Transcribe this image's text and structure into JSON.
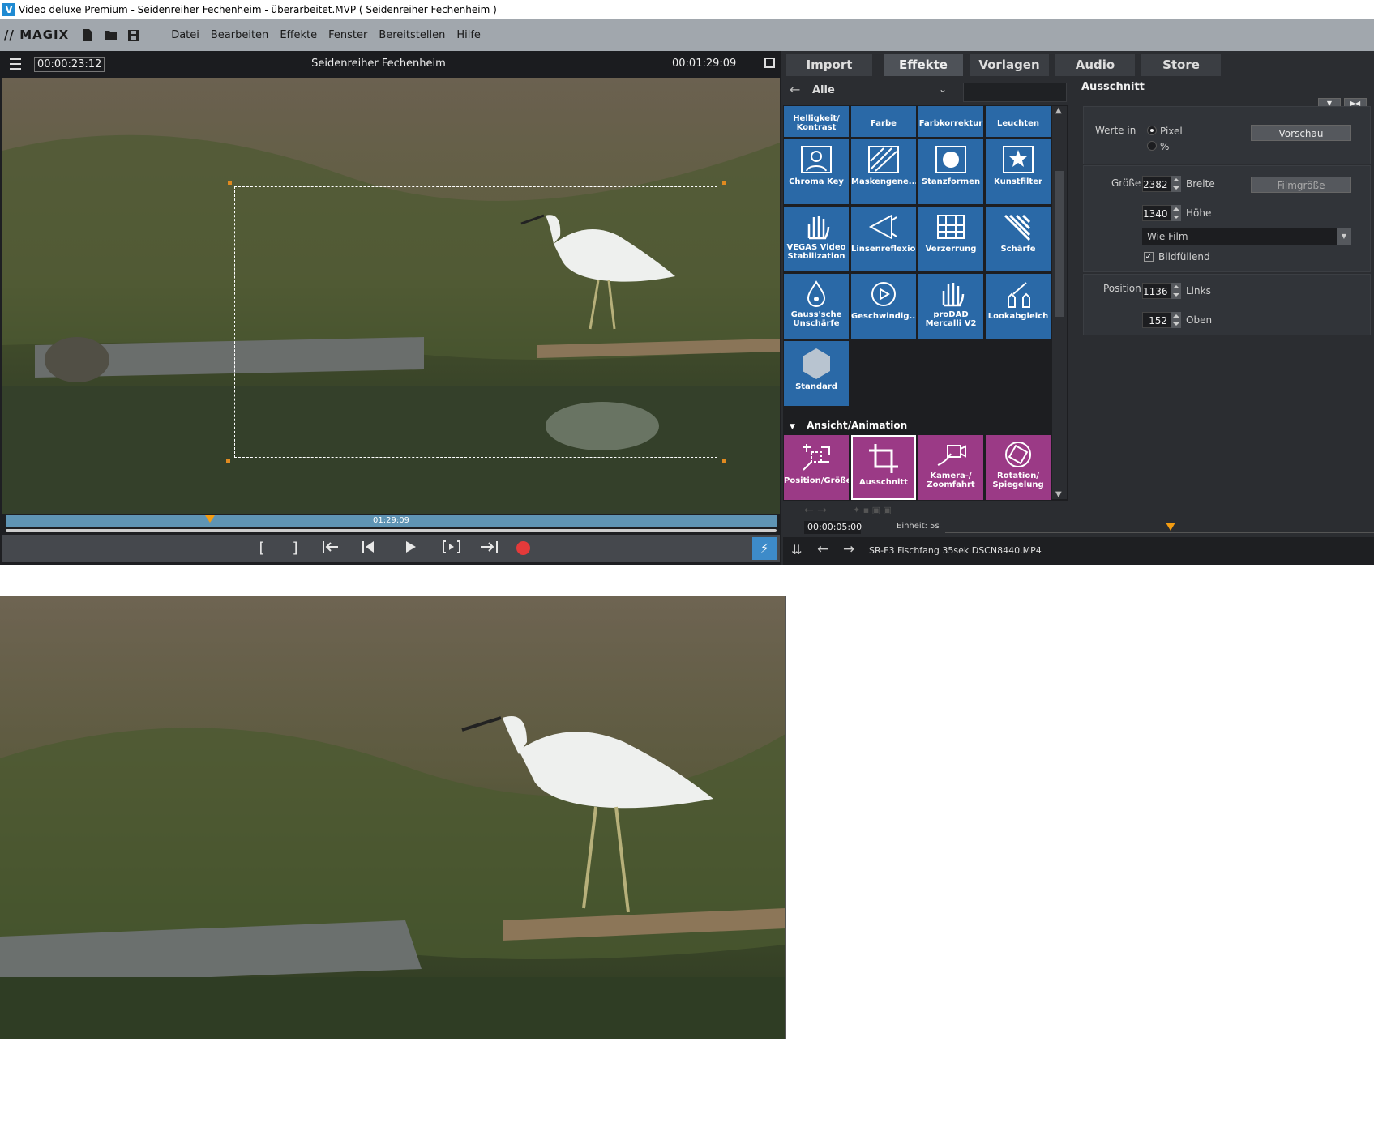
{
  "window": {
    "title": "Video deluxe Premium - Seidenreiher Fechenheim - überarbeitet.MVP ( Seidenreiher Fechenheim )",
    "logo": "V"
  },
  "brand": "MAGIX",
  "menu": [
    "Datei",
    "Bearbeiten",
    "Effekte",
    "Fenster",
    "Bereitstellen",
    "Hilfe"
  ],
  "preview": {
    "timecode_current": "00:00:23:12",
    "title": "Seidenreiher Fechenheim",
    "timecode_total": "00:01:29:09",
    "scrub_label": "01:29:09",
    "playhead_fraction": 0.265
  },
  "tabs": [
    "Import",
    "Effekte",
    "Vorlagen",
    "Audio",
    "Store"
  ],
  "browser": {
    "category": "Alle",
    "tiles": [
      {
        "label": "Helligkeit/ Kontrast",
        "icon": "brightness-icon"
      },
      {
        "label": "Farbe",
        "icon": "color-icon"
      },
      {
        "label": "Farbkorrektur",
        "icon": "color-correction-icon"
      },
      {
        "label": "Leuchten",
        "icon": "glow-icon"
      },
      {
        "label": "Chroma Key",
        "icon": "chroma-key-icon"
      },
      {
        "label": "Maskengene...",
        "icon": "mask-icon"
      },
      {
        "label": "Stanzformen",
        "icon": "shapes-icon"
      },
      {
        "label": "Kunstfilter",
        "icon": "art-filter-icon"
      },
      {
        "label": "VEGAS Video Stabilization",
        "icon": "stabilization-icon"
      },
      {
        "label": "Linsenreflexion",
        "icon": "lens-flare-icon"
      },
      {
        "label": "Verzerrung",
        "icon": "distortion-icon"
      },
      {
        "label": "Schärfe",
        "icon": "sharpness-icon"
      },
      {
        "label": "Gauss'sche Unschärfe",
        "icon": "blur-icon"
      },
      {
        "label": "Geschwindig...",
        "icon": "speed-icon"
      },
      {
        "label": "proDAD Mercalli V2",
        "icon": "mercalli-icon"
      },
      {
        "label": "Lookabgleich",
        "icon": "look-match-icon"
      },
      {
        "label": "Standard",
        "icon": "hexagon-icon"
      }
    ],
    "section": "Ansicht/Animation",
    "anim_tiles": [
      {
        "label": "Position/Größe",
        "icon": "position-icon"
      },
      {
        "label": "Ausschnitt",
        "icon": "crop-icon"
      },
      {
        "label": "Kamera-/ Zoomfahrt",
        "icon": "camera-zoom-icon"
      },
      {
        "label": "Rotation/ Spiegelung",
        "icon": "rotation-icon"
      }
    ]
  },
  "properties": {
    "title": "Ausschnitt",
    "werte_in": "Werte in",
    "opt_pixel": "Pixel",
    "opt_percent": "%",
    "vorschau": "Vorschau",
    "groesse": "Größe",
    "breite_val": "2382",
    "breite": "Breite",
    "filmgroesse": "Filmgröße",
    "hoehe_val": "1340",
    "hoehe": "Höhe",
    "dropdown": "Wie Film",
    "bildfuellend": "Bildfüllend",
    "position": "Position",
    "links_val": "1136",
    "links": "Links",
    "oben_val": "152",
    "oben": "Oben"
  },
  "timeline": {
    "time": "00:00:05:00",
    "unit": "Einheit: 5s"
  },
  "status": {
    "clip": "SR-F3 Fischfang 35sek DSCN8440.MP4"
  }
}
